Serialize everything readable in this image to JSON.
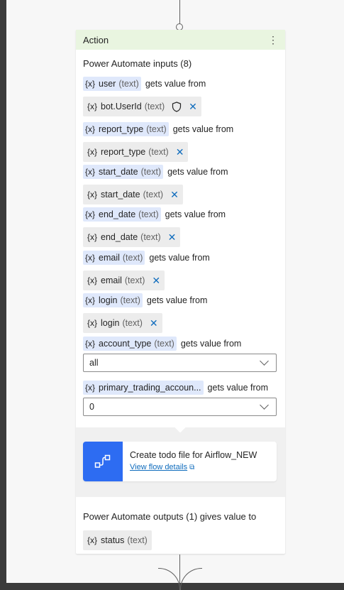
{
  "card": {
    "header_title": "Action",
    "more_icon": "more-vertical-icon",
    "inputs_title": "Power Automate inputs (8)",
    "outputs_title": "Power Automate outputs (1) gives value to"
  },
  "var_prefix": "{x}",
  "gets_value_from": "gets value from",
  "inputs": [
    {
      "name": "user",
      "type": "(text)",
      "value_name": "bot.UserId",
      "value_type": "(text)"
    },
    {
      "name": "report_type",
      "type": "(text)",
      "value_name": "report_type",
      "value_type": "(text)"
    },
    {
      "name": "start_date",
      "type": "(text)",
      "value_name": "start_date",
      "value_type": "(text)"
    },
    {
      "name": "end_date",
      "type": "(text)",
      "value_name": "end_date",
      "value_type": "(text)"
    },
    {
      "name": "email",
      "type": "(text)",
      "value_name": "email",
      "value_type": "(text)"
    },
    {
      "name": "login",
      "type": "(text)",
      "value_name": "login",
      "value_type": "(text)"
    },
    {
      "name": "account_type",
      "type": "(text)",
      "dropdown_value": "all"
    },
    {
      "name": "primary_trading_accoun...",
      "type": "",
      "dropdown_value": "0"
    }
  ],
  "flow": {
    "title": "Create todo file for Airflow_NEW",
    "link": "View flow details",
    "icon": "flow-icon"
  },
  "outputs": [
    {
      "name": "status",
      "type": "(text)"
    }
  ],
  "colors": {
    "header_bg": "#e9f5e0",
    "var_chip_bg": "#dfe8fb",
    "value_chip_bg": "#ececec",
    "flow_icon_bg": "#2d6cf2",
    "link": "#0f6cbd"
  }
}
